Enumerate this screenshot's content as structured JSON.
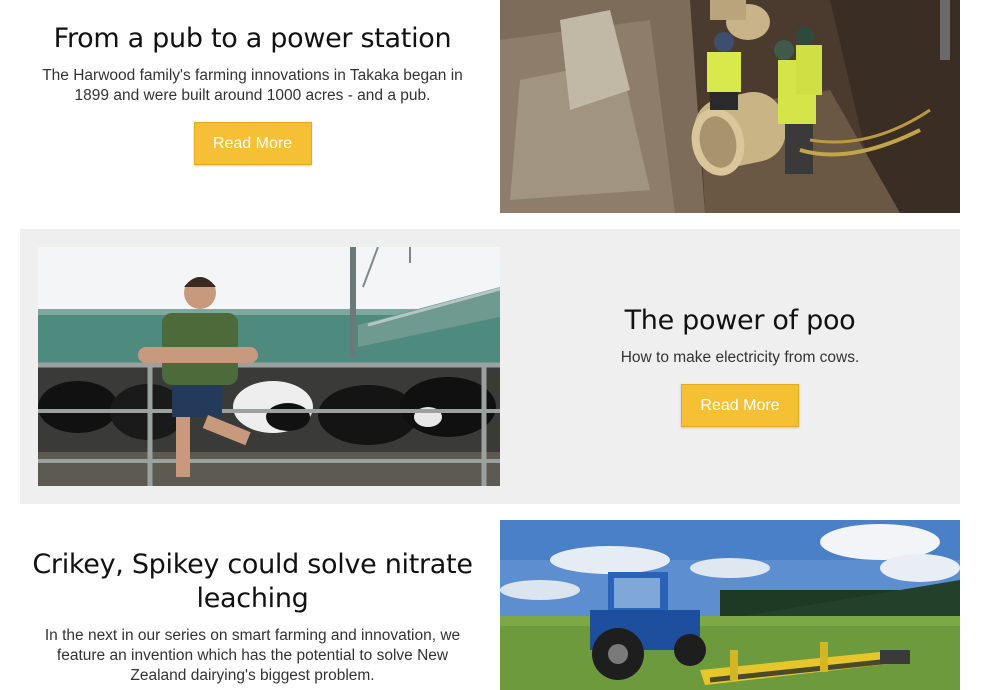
{
  "articles": [
    {
      "title": "From a pub to a power station",
      "description": "The Harwood family's farming innovations in Takaka began in 1899 and were built around 1000 acres - and a pub.",
      "button_label": "Read More"
    },
    {
      "title": "The power of poo",
      "description": "How to make electricity from cows.",
      "button_label": "Read More"
    },
    {
      "title": "Crikey, Spikey could solve nitrate leaching",
      "description": "In the next in our series on smart farming and innovation, we feature an invention which has the potential to solve New Zealand dairying's biggest problem."
    }
  ],
  "colors": {
    "button": "#f5c034",
    "card_gray": "#efefef",
    "background": "#ffffff"
  }
}
